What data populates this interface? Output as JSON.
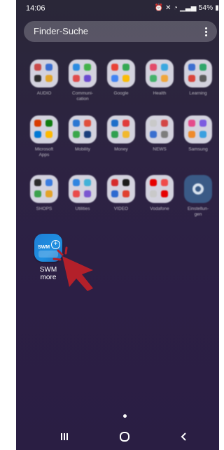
{
  "status_bar": {
    "time": "14:06",
    "battery": "54%",
    "icons": [
      "alarm-icon",
      "mute-icon",
      "wifi-icon",
      "signal-icon",
      "battery-icon"
    ]
  },
  "search": {
    "placeholder": "Finder-Suche",
    "more_icon": "more-vertical-icon"
  },
  "folders": [
    [
      {
        "label": "AUDIO"
      },
      {
        "label": "Communi-\ncation"
      },
      {
        "label": "Google"
      },
      {
        "label": "Health"
      },
      {
        "label": "Learning"
      }
    ],
    [
      {
        "label": "Microsoft\nApps"
      },
      {
        "label": "Mobility"
      },
      {
        "label": "Money"
      },
      {
        "label": "NEWS"
      },
      {
        "label": "Samsung"
      }
    ],
    [
      {
        "label": "SHOPS"
      },
      {
        "label": "Utilities"
      },
      {
        "label": "VIDEO"
      },
      {
        "label": "Vodafone"
      },
      {
        "label": "Einstellun-\ngen"
      }
    ]
  ],
  "featured_app": {
    "label": "SWM\nmore",
    "icon_text": "SWM"
  },
  "colors": {
    "background": "#2c1f45",
    "accent_cursor": "#b3202a",
    "swm_blue": "#1f7fd6"
  },
  "nav": {
    "recents_icon": "recents-icon",
    "home_icon": "home-icon",
    "back_icon": "back-icon"
  }
}
